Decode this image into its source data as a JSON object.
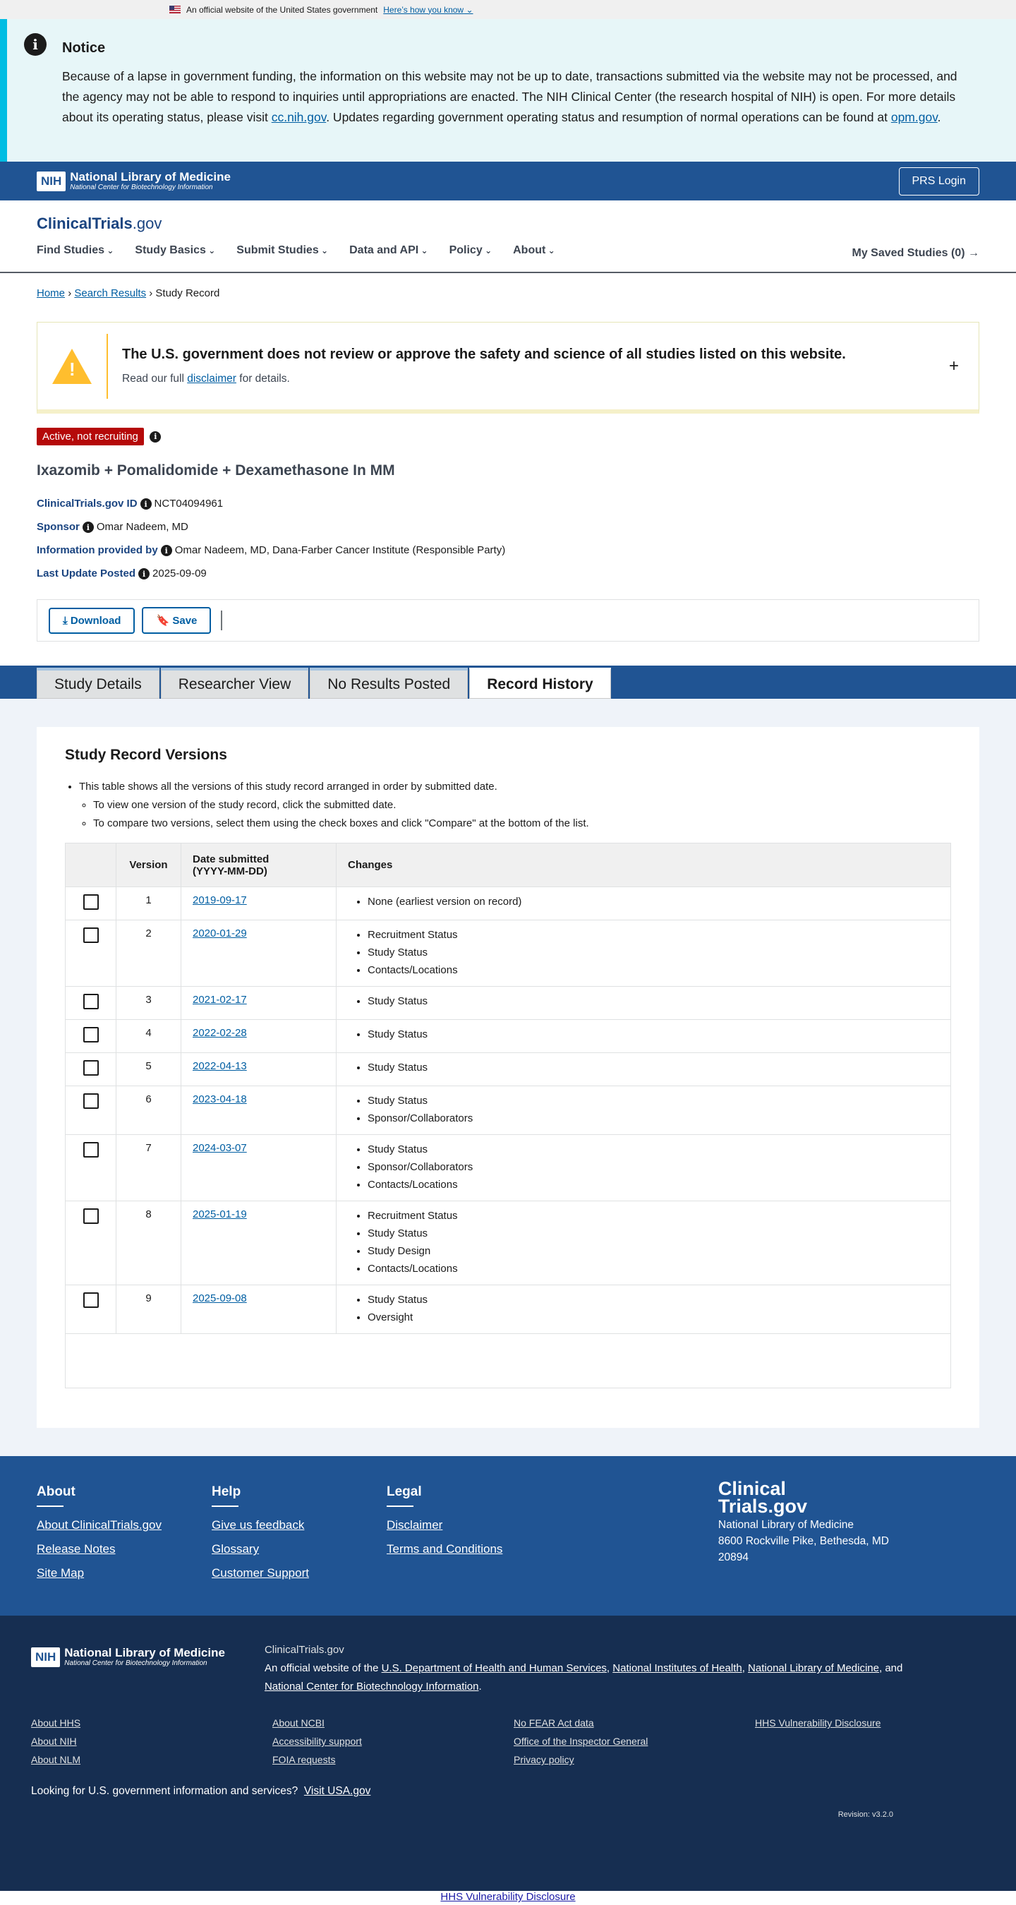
{
  "gov_banner": {
    "text": "An official website of the United States government",
    "link": "Here’s how you know"
  },
  "notice": {
    "title": "Notice",
    "body_1": "Because of a lapse in government funding, the information on this website may not be up to date, transactions submitted via the website may not be processed, and the agency may not be able to respond to inquiries until appropriations are enacted. The NIH Clinical Center (the research hospital of NIH) is open. For more details about its operating status, please visit ",
    "link_1": "cc.nih.gov",
    "body_2": ". Updates regarding government operating status and resumption of normal operations can be found at ",
    "link_2": "opm.gov",
    "body_3": "."
  },
  "nih_header": {
    "box": "NIH",
    "title": "National Library of Medicine",
    "subtitle": "National Center for Biotechnology Information",
    "login": "PRS Login"
  },
  "ct_header": {
    "logo_main": "ClinicalTrials",
    "logo_gov": ".gov",
    "nav": [
      "Find Studies",
      "Study Basics",
      "Submit Studies",
      "Data and API",
      "Policy",
      "About"
    ],
    "saved": "My Saved Studies (0)"
  },
  "breadcrumb": {
    "home": "Home",
    "search": "Search Results",
    "current": "Study Record"
  },
  "disclaimer": {
    "title": "The U.S. government does not review or approve the safety and science of all studies listed on this website.",
    "pre": "Read our full ",
    "link": "disclaimer",
    "post": " for details."
  },
  "study": {
    "status": "Active, not recruiting",
    "title": "Ixazomib + Pomalidomide + Dexamethasone In MM",
    "id_label": "ClinicalTrials.gov ID",
    "id_value": "NCT04094961",
    "sponsor_label": "Sponsor",
    "sponsor_value": "Omar Nadeem, MD",
    "info_label": "Information provided by",
    "info_value": "Omar Nadeem, MD, Dana-Farber Cancer Institute (Responsible Party)",
    "update_label": "Last Update Posted",
    "update_value": "2025-09-09"
  },
  "actions": {
    "download": "Download",
    "save": "Save"
  },
  "tabs": [
    "Study Details",
    "Researcher View",
    "No Results Posted",
    "Record History"
  ],
  "versions": {
    "title": "Study Record Versions",
    "bullet": "This table shows all the versions of this study record arranged in order by submitted date.",
    "sub_1": "To view one version of the study record, click the submitted date.",
    "sub_2": "To compare two versions, select them using the check boxes and click \"Compare\" at the bottom of the list.",
    "col_version": "Version",
    "col_date_1": "Date submitted",
    "col_date_2": "(YYYY-MM-DD)",
    "col_changes": "Changes",
    "rows": [
      {
        "v": "1",
        "date": "2019-09-17",
        "changes": [
          "None (earliest version on record)"
        ]
      },
      {
        "v": "2",
        "date": "2020-01-29",
        "changes": [
          "Recruitment Status",
          "Study Status",
          "Contacts/Locations"
        ]
      },
      {
        "v": "3",
        "date": "2021-02-17",
        "changes": [
          "Study Status"
        ]
      },
      {
        "v": "4",
        "date": "2022-02-28",
        "changes": [
          "Study Status"
        ]
      },
      {
        "v": "5",
        "date": "2022-04-13",
        "changes": [
          "Study Status"
        ]
      },
      {
        "v": "6",
        "date": "2023-04-18",
        "changes": [
          "Study Status",
          "Sponsor/Collaborators"
        ]
      },
      {
        "v": "7",
        "date": "2024-03-07",
        "changes": [
          "Study Status",
          "Sponsor/Collaborators",
          "Contacts/Locations"
        ]
      },
      {
        "v": "8",
        "date": "2025-01-19",
        "changes": [
          "Recruitment Status",
          "Study Status",
          "Study Design",
          "Contacts/Locations"
        ]
      },
      {
        "v": "9",
        "date": "2025-09-08",
        "changes": [
          "Study Status",
          "Oversight"
        ]
      }
    ]
  },
  "footer": {
    "about": {
      "title": "About",
      "links": [
        "About ClinicalTrials.gov",
        "Release Notes",
        "Site Map"
      ]
    },
    "help": {
      "title": "Help",
      "links": [
        "Give us feedback",
        "Glossary",
        "Customer Support"
      ]
    },
    "legal": {
      "title": "Legal",
      "links": [
        "Disclaimer",
        "Terms and Conditions"
      ]
    },
    "logo_1": "Clinical",
    "logo_2": "Trials.gov",
    "org": "National Library of Medicine",
    "address_1": "8600 Rockville Pike, Bethesda, MD",
    "address_2": "20894"
  },
  "footer2": {
    "site": "ClinicalTrials.gov",
    "desc_pre": "An official website of the ",
    "l1": "U.S. Department of Health and Human Services",
    "l2": "National Institutes of Health",
    "l3": "National Library of Medicine",
    "and": "and ",
    "l4": "National Center for Biotechnology Information",
    "links": [
      "About HHS",
      "About NCBI",
      "No FEAR Act data",
      "HHS Vulnerability Disclosure",
      "About NIH",
      "Accessibility support",
      "Office of the Inspector General",
      "",
      "About NLM",
      "FOIA requests",
      "Privacy policy",
      ""
    ],
    "usa_text": "Looking for U.S. government information and services?",
    "usa_link": "Visit USA.gov",
    "revision": "Revision: v3.2.0"
  },
  "bottom_link": "HHS Vulnerability Disclosure"
}
